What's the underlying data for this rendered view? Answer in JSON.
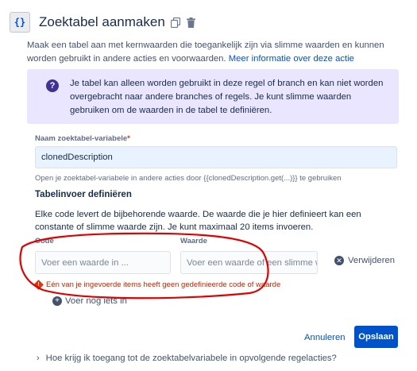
{
  "header": {
    "badge": "{}",
    "title": "Zoektabel aanmaken"
  },
  "description": {
    "text": "Maak een tabel aan met kernwaarden die toegankelijk zijn via slimme waarden en kunnen worden gebruikt in andere acties en voorwaarden.",
    "link": "Meer informatie over deze actie"
  },
  "info_panel": {
    "icon_glyph": "?",
    "text": "Je tabel kan alleen worden gebruikt in deze regel of branch en kan niet worden overgebracht naar andere branches of regels. Je kunt slimme waarden gebruiken om de waarden in de tabel te definiëren."
  },
  "variable_field": {
    "label": "Naam zoektabel-variabele",
    "required_marker": "*",
    "value": "clonedDescription",
    "helper": "Open je zoektabel-variabele in andere acties door {{clonedDescription.get(...)}} te gebruiken"
  },
  "table_section": {
    "title": "Tabelinvoer definiëren",
    "description": "Elke code levert de bijbehorende waarde. De waarde die je hier definieert kan een constante of slimme waarde zijn. Je kunt maximaal 20 items invoeren.",
    "columns": {
      "code": "Code",
      "value": "Waarde"
    },
    "row": {
      "code_placeholder": "Voer een waarde in ...",
      "value_placeholder": "Voer een waarde of een slimme wa",
      "remove_label": "Verwijderen"
    },
    "error": "Eén van je ingevoerde items heeft geen gedefinieerde code of waarde",
    "add_more": "Voer nog iets in"
  },
  "actions": {
    "cancel": "Annuleren",
    "save": "Opslaan"
  },
  "faq": {
    "label": "Hoe krijg ik toegang tot de zoektabelvariabele in opvolgende regelacties?"
  },
  "colors": {
    "primary": "#0052cc",
    "info_bg": "#eae6ff",
    "error": "#bf2600",
    "annotation": "#e00000"
  },
  "icons": [
    "curly-braces-icon",
    "copy-icon",
    "trash-icon",
    "question-icon",
    "remove-icon",
    "error-icon",
    "plus-icon",
    "chevron-right-icon"
  ]
}
